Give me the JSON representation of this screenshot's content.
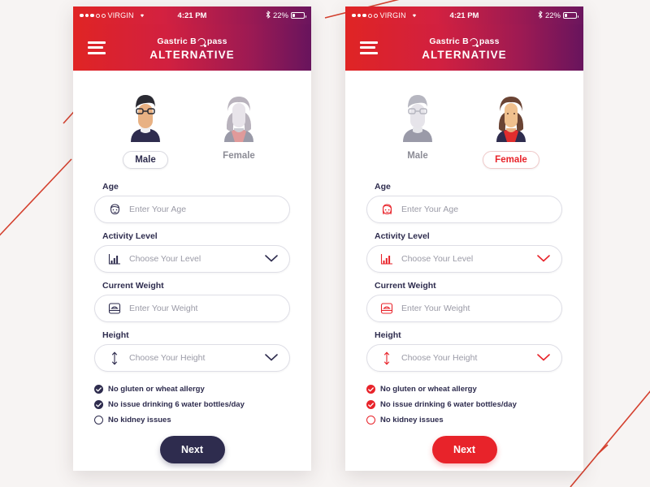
{
  "canvas": {
    "background_color": "#f7f4f3",
    "accent_red": "#e8232a",
    "accent_navy": "#2e2c4e",
    "decor": "red-diagonal-lines"
  },
  "status_bar": {
    "carrier": "VIRGIN",
    "signal_dots_filled": 3,
    "signal_dots_empty": 2,
    "wifi_icon": "wifi-icon",
    "time": "4:21 PM",
    "bluetooth_icon": "bluetooth-icon",
    "battery_percent": "22%",
    "battery_icon": "battery-icon"
  },
  "navbar": {
    "menu_icon": "hamburger-menu-icon",
    "logo_line1": "Gastric B",
    "logo_line1_suffix": "pass",
    "logo_line2": "ALTERNATIVE"
  },
  "phones": [
    {
      "variant": "male-selected",
      "theme_color": "#2e2c4e",
      "gender": {
        "male": {
          "label": "Male",
          "selected": true,
          "avatar": "male-avatar-icon"
        },
        "female": {
          "label": "Female",
          "selected": false,
          "avatar": "female-avatar-icon"
        }
      },
      "fields": [
        {
          "label": "Age",
          "placeholder": "Enter Your Age",
          "icon": "male-face-icon",
          "type": "text"
        },
        {
          "label": "Activity Level",
          "placeholder": "Choose Your Level",
          "icon": "bar-chart-icon",
          "type": "select"
        },
        {
          "label": "Current Weight",
          "placeholder": "Enter Your Weight",
          "icon": "weight-scale-icon",
          "type": "text"
        },
        {
          "label": "Height",
          "placeholder": "Choose Your Height",
          "icon": "height-arrow-icon",
          "type": "select"
        }
      ],
      "checks": [
        {
          "label": "No gluten or wheat allergy",
          "checked": true
        },
        {
          "label": "No issue drinking 6 water bottles/day",
          "checked": true
        },
        {
          "label": "No kidney issues",
          "checked": false
        }
      ],
      "next_label": "Next"
    },
    {
      "variant": "female-selected",
      "theme_color": "#e8232a",
      "gender": {
        "male": {
          "label": "Male",
          "selected": false,
          "avatar": "male-avatar-icon"
        },
        "female": {
          "label": "Female",
          "selected": true,
          "avatar": "female-avatar-icon"
        }
      },
      "fields": [
        {
          "label": "Age",
          "placeholder": "Enter Your Age",
          "icon": "female-face-icon",
          "type": "text"
        },
        {
          "label": "Activity Level",
          "placeholder": "Choose Your Level",
          "icon": "bar-chart-icon",
          "type": "select"
        },
        {
          "label": "Current Weight",
          "placeholder": "Enter Your Weight",
          "icon": "weight-scale-icon",
          "type": "text"
        },
        {
          "label": "Height",
          "placeholder": "Choose Your Height",
          "icon": "height-arrow-icon",
          "type": "select"
        }
      ],
      "checks": [
        {
          "label": "No gluten or wheat allergy",
          "checked": true
        },
        {
          "label": "No issue drinking 6 water bottles/day",
          "checked": true
        },
        {
          "label": "No kidney issues",
          "checked": false
        }
      ],
      "next_label": "Next"
    }
  ]
}
